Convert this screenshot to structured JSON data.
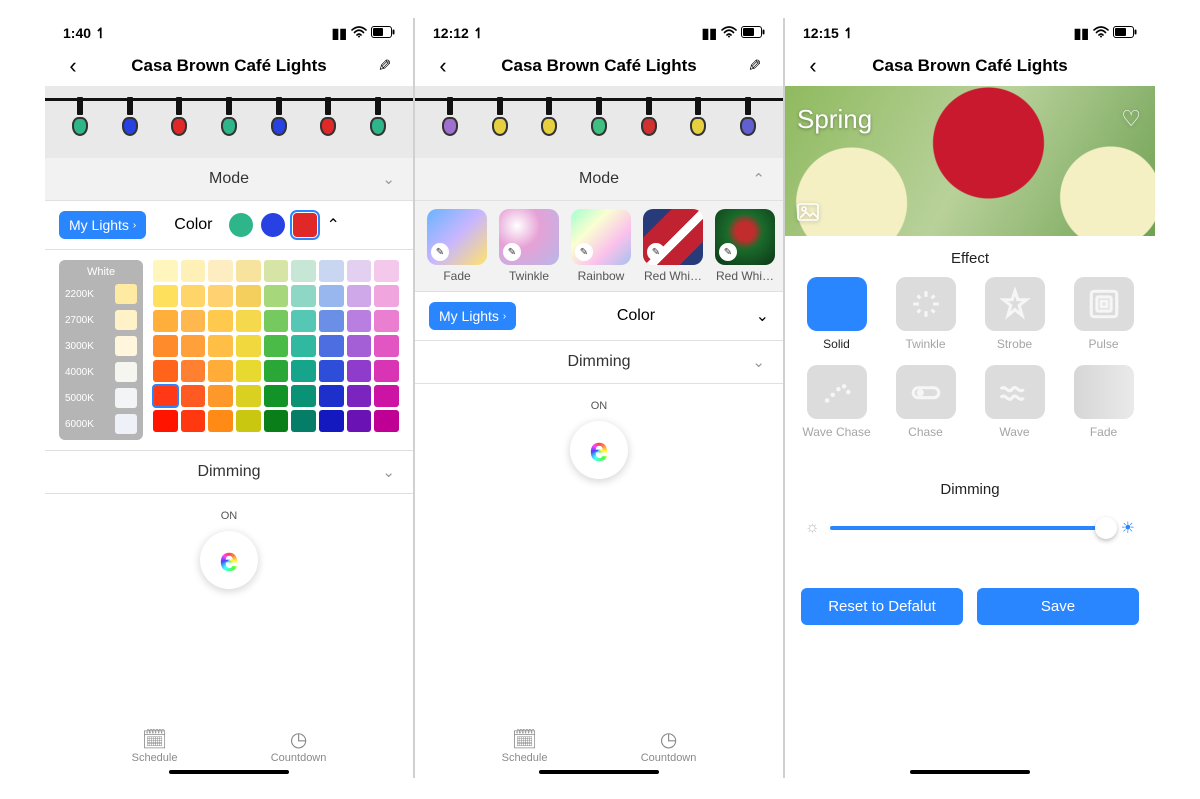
{
  "screen1": {
    "status_time": "1:40",
    "title": "Casa Brown Café Lights",
    "mode_label": "Mode",
    "my_lights_label": "My Lights",
    "color_label": "Color",
    "selected_colors": [
      "#2eb58a",
      "#2741e2",
      "#e02828"
    ],
    "kelvin_title": "White",
    "kelvins": [
      {
        "label": "2200K",
        "color": "#ffeaa3"
      },
      {
        "label": "2700K",
        "color": "#fff1c8"
      },
      {
        "label": "3000K",
        "color": "#fff6dd"
      },
      {
        "label": "4000K",
        "color": "#f6f6f1"
      },
      {
        "label": "5000K",
        "color": "#f2f4f6"
      },
      {
        "label": "6000K",
        "color": "#eef2f8"
      }
    ],
    "palette": [
      "#fff6bd",
      "#fff0b8",
      "#ffedc2",
      "#f8e39e",
      "#d6e5a5",
      "#c8e6d6",
      "#c8d6f2",
      "#e3cff0",
      "#f4c8ea",
      "#ffe05c",
      "#ffd56a",
      "#ffd170",
      "#f4cf5e",
      "#a6d77a",
      "#8fd7c5",
      "#98b7ef",
      "#cfa8ea",
      "#f0a5df",
      "#ffaf3a",
      "#ffb84d",
      "#ffc94d",
      "#f6d84c",
      "#76c95e",
      "#56c7b4",
      "#6b8fe6",
      "#b97fe0",
      "#ea7ed1",
      "#ff8b2a",
      "#ffa03b",
      "#ffbe45",
      "#f0d83e",
      "#4bbb48",
      "#30b8a0",
      "#4c6ee0",
      "#a45ed6",
      "#e256c4",
      "#ff641a",
      "#ff8030",
      "#ffad38",
      "#e7d930",
      "#2aa736",
      "#16a58a",
      "#2e4dd8",
      "#8f3bcc",
      "#d934b4",
      "#ff3815",
      "#ff5a22",
      "#ff982a",
      "#d9d022",
      "#119327",
      "#0a9277",
      "#1e30cc",
      "#7b24c0",
      "#cd13a4",
      "#ff1400",
      "#ff3810",
      "#ff8a16",
      "#c9c710",
      "#0a7f19",
      "#067e67",
      "#1319bf",
      "#6a12b3",
      "#c00094"
    ],
    "palette_selection": 45,
    "dimming_label": "Dimming",
    "on_label": "ON",
    "tab_schedule": "Schedule",
    "tab_countdown": "Countdown"
  },
  "screen2": {
    "status_time": "12:12",
    "title": "Casa Brown Café Lights",
    "mode_label": "Mode",
    "modes": [
      "Fade",
      "Twinkle",
      "Rainbow",
      "Red Whi…",
      "Red Whi…"
    ],
    "my_lights_label": "My Lights",
    "color_label": "Color",
    "dimming_label": "Dimming",
    "on_label": "ON",
    "tab_schedule": "Schedule",
    "tab_countdown": "Countdown",
    "bulb_colors": [
      "#a070d0",
      "#e7d040",
      "#e7d040",
      "#40c080",
      "#d03030",
      "#e7d040",
      "#6060d0"
    ]
  },
  "screen3": {
    "status_time": "12:15",
    "title": "Casa Brown Café Lights",
    "hero_title": "Spring",
    "effect_label": "Effect",
    "effects": [
      "Solid",
      "Twinkle",
      "Strobe",
      "Pulse",
      "Wave Chase",
      "Chase",
      "Wave",
      "Fade"
    ],
    "effect_selected": 0,
    "dimming_label": "Dimming",
    "reset_label": "Reset to Defalut",
    "save_label": "Save"
  }
}
